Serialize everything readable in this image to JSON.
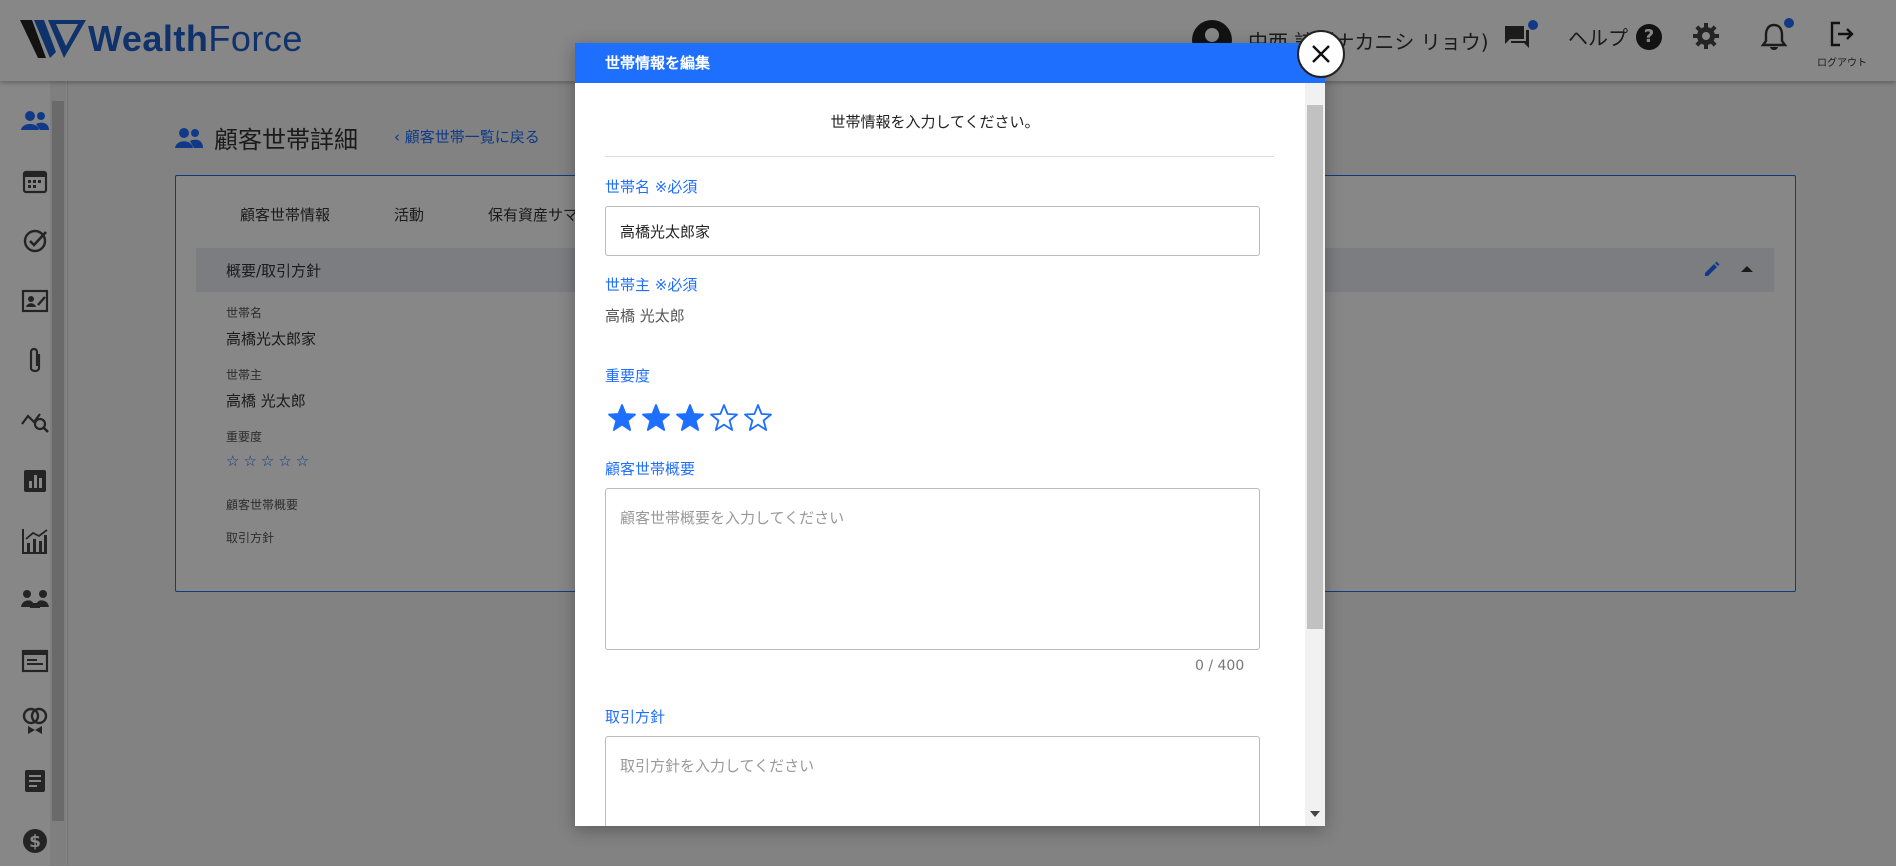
{
  "header": {
    "logo_text_bold": "Wealth",
    "logo_text_light": "Force",
    "user_name": "中西 諒（ナカニシ リョウ)",
    "help_label": "ヘルプ",
    "logout_label": "ログアウト",
    "accent_color": "#1f6fff"
  },
  "sidebar": {
    "icons": [
      "people-icon",
      "calendar-icon",
      "check-circle-icon",
      "contact-card-icon",
      "paperclip-icon",
      "chart-search-icon",
      "bar-chart-icon",
      "growth-chart-icon",
      "meeting-icon",
      "document-icon",
      "rings-icon",
      "note-icon",
      "dollar-icon"
    ]
  },
  "main": {
    "page_title": "顧客世帯詳細",
    "back_link": "顧客世帯一覧に戻る",
    "tabs": [
      {
        "label": "顧客世帯情報",
        "active": true
      },
      {
        "label": "活動",
        "active": false
      },
      {
        "label": "保有資産サマリ",
        "active": false
      }
    ],
    "section_title": "概要/取引方針",
    "fields": {
      "household_name_label": "世帯名",
      "household_name_value": "高橋光太郎家",
      "head_label": "世帯主",
      "head_value": "高橋 光太郎",
      "importance_label": "重要度",
      "importance_stars": "☆☆☆☆☆",
      "summary_label": "顧客世帯概要",
      "policy_label": "取引方針"
    }
  },
  "dialog": {
    "title": "世帯情報を編集",
    "intro": "世帯情報を入力してください。",
    "household_name_label": "世帯名 ※必須",
    "household_name_value": "高橋光太郎家",
    "head_label": "世帯主 ※必須",
    "head_value": "高橋 光太郎",
    "importance_label": "重要度",
    "importance_rating": 3,
    "importance_max": 5,
    "summary_label": "顧客世帯概要",
    "summary_placeholder": "顧客世帯概要を入力してください",
    "summary_counter": "0 / 400",
    "policy_label": "取引方針",
    "policy_placeholder": "取引方針を入力してください"
  }
}
